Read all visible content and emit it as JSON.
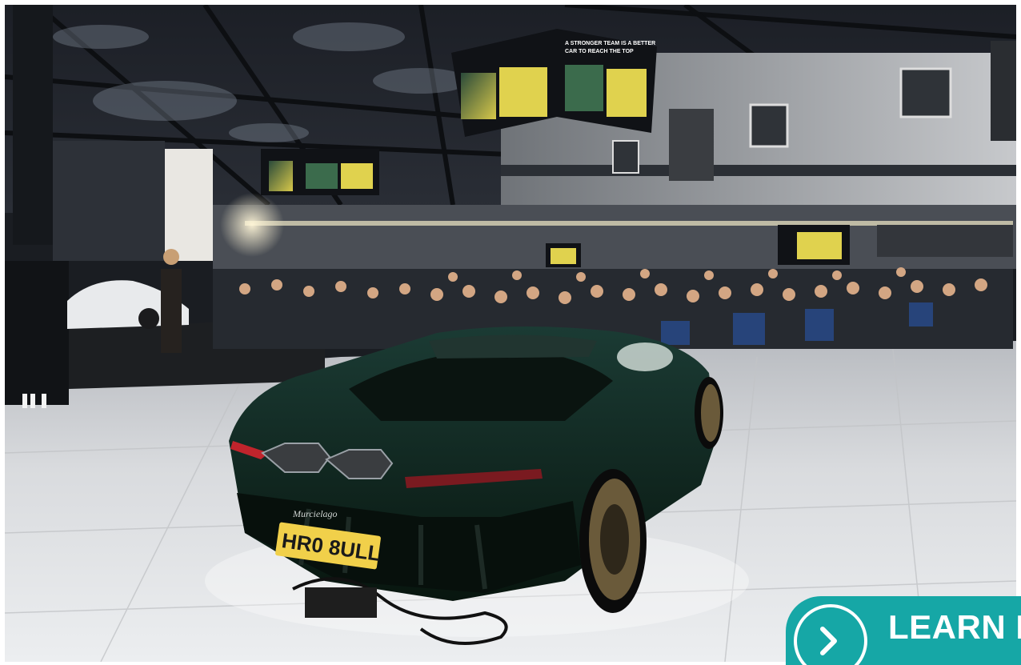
{
  "photo": {
    "screen_caption_line1": "A STRONGER TEAM IS A BETTER",
    "screen_caption_line2": "CAR TO REACH THE TOP",
    "plate": "HR0 8ULL",
    "badge": "Murcielago"
  },
  "cta": {
    "label": "LEARN MO",
    "icon": "chevron-right-icon"
  },
  "colors": {
    "cta_bg": "#16a7a6",
    "car_body": "#0e2a24"
  }
}
